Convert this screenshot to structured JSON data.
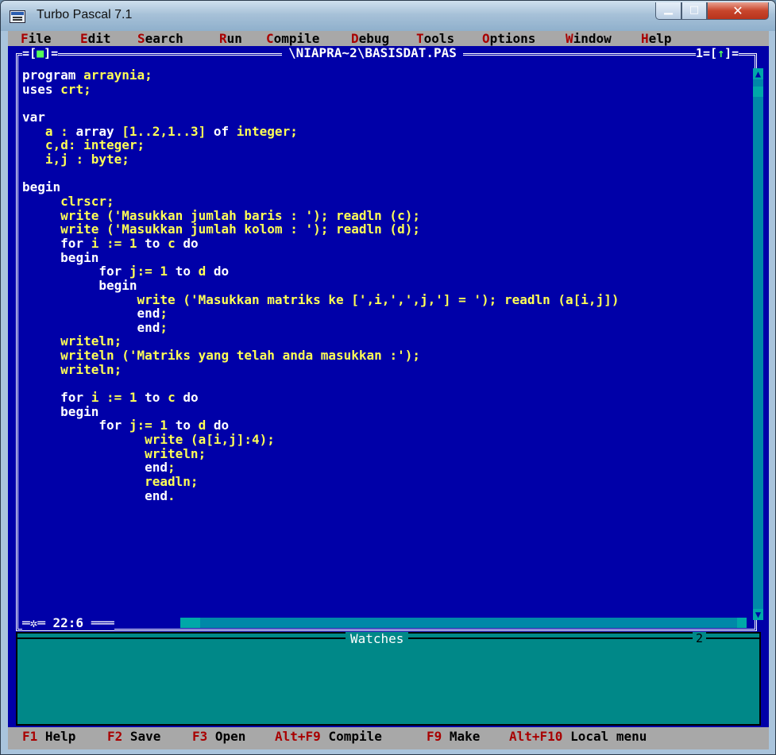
{
  "window": {
    "title": "Turbo Pascal 7.1"
  },
  "menu": [
    {
      "hotkey": "F",
      "rest": "ile"
    },
    {
      "hotkey": "E",
      "rest": "dit"
    },
    {
      "hotkey": "S",
      "rest": "earch"
    },
    {
      "hotkey": "R",
      "rest": "un"
    },
    {
      "hotkey": "C",
      "rest": "ompile"
    },
    {
      "hotkey": "D",
      "rest": "ebug"
    },
    {
      "hotkey": "T",
      "rest": "ools"
    },
    {
      "hotkey": "O",
      "rest": "ptions"
    },
    {
      "hotkey": "W",
      "rest": "indow"
    },
    {
      "hotkey": "H",
      "rest": "elp"
    }
  ],
  "editor": {
    "filename": "\\NIAPRA~2\\BASISDAT.PAS",
    "close_box_left": "=[",
    "close_box_glyph": "■",
    "close_box_right": "]=",
    "window_number": "1=[",
    "zoom_glyph": "↑",
    "window_number_end": "]=",
    "cursor_position": "22:6",
    "lines": [
      [
        "program ",
        "arraynia;"
      ],
      [
        "uses ",
        "crt;"
      ],
      [
        "",
        ""
      ],
      [
        "var",
        ""
      ],
      [
        "   ",
        "a : array [1..2,1..3] of integer;"
      ],
      [
        "   ",
        "c,d: integer;"
      ],
      [
        "   ",
        "i,j : byte;"
      ],
      [
        "",
        ""
      ],
      [
        "begin",
        ""
      ],
      [
        "     ",
        "clrscr;"
      ],
      [
        "     ",
        "write ('Masukkan jumlah baris : '); readln (c);"
      ],
      [
        "     ",
        "write ('Masukkan jumlah kolom : '); readln (d);"
      ],
      [
        "     ",
        "for i := 1 to c do"
      ],
      [
        "     ",
        "begin"
      ],
      [
        "          ",
        "for j:= 1 to d do"
      ],
      [
        "          ",
        "begin"
      ],
      [
        "               ",
        "write ('Masukkan matriks ke [',i,',',j,'] = '); readln (a[i,j])"
      ],
      [
        "               ",
        "end;"
      ],
      [
        "               ",
        "end;"
      ],
      [
        "     ",
        "writeln;"
      ],
      [
        "     ",
        "writeln ('Matriks yang telah anda masukkan :');"
      ],
      [
        "     ",
        "writeln;"
      ],
      [
        "",
        ""
      ],
      [
        "     ",
        "for i := 1 to c do"
      ],
      [
        "     ",
        "begin"
      ],
      [
        "          ",
        "for j:= 1 to d do"
      ],
      [
        "                ",
        "write (a[i,j]:4);"
      ],
      [
        "                ",
        "writeln;"
      ],
      [
        "                ",
        "end;"
      ],
      [
        "                ",
        "readln;"
      ],
      [
        "                ",
        "end."
      ]
    ]
  },
  "watches": {
    "title": "Watches",
    "number": "2"
  },
  "function_keys": [
    {
      "key": "F1",
      "label": "Help"
    },
    {
      "key": "F2",
      "label": "Save"
    },
    {
      "key": "F3",
      "label": "Open"
    },
    {
      "key": "Alt+F9",
      "label": "Compile"
    },
    {
      "key": "F9",
      "label": "Make"
    },
    {
      "key": "Alt+F10",
      "label": "Local menu"
    }
  ],
  "colors": {
    "editor_bg": "#0000a8",
    "menu_bg": "#a8a8a8",
    "watch_bg": "#008888",
    "hotkey": "#a80000",
    "code_text": "#ffff55"
  }
}
